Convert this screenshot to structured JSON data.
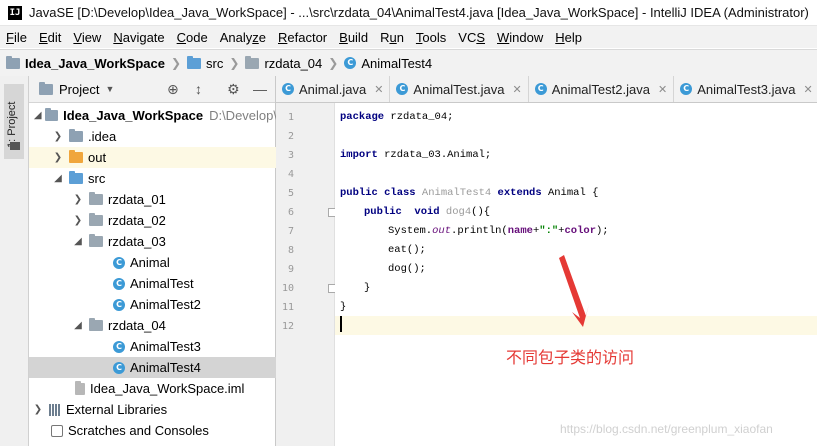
{
  "window": {
    "app_icon": "IJ",
    "title": "JavaSE [D:\\Develop\\Idea_Java_WorkSpace] - ...\\src\\rzdata_04\\AnimalTest4.java [Idea_Java_WorkSpace] - IntelliJ IDEA (Administrator)"
  },
  "menu": {
    "file": {
      "u": "F",
      "rest": "ile"
    },
    "edit": {
      "u": "E",
      "rest": "dit"
    },
    "view": {
      "u": "V",
      "rest": "iew"
    },
    "navigate": {
      "u": "N",
      "rest": "avigate"
    },
    "code": {
      "u": "C",
      "rest": "ode"
    },
    "analyze": {
      "pre": "Analy",
      "u": "z",
      "rest": "e"
    },
    "refactor": {
      "u": "R",
      "rest": "efactor"
    },
    "build": {
      "u": "B",
      "rest": "uild"
    },
    "run": {
      "pre": "R",
      "u": "u",
      "rest": "n"
    },
    "tools": {
      "u": "T",
      "rest": "ools"
    },
    "vcs": {
      "pre": "VC",
      "u": "S",
      "rest": ""
    },
    "window": {
      "u": "W",
      "rest": "indow"
    },
    "help": {
      "u": "H",
      "rest": "elp"
    }
  },
  "breadcrumbs": [
    "Idea_Java_WorkSpace",
    "src",
    "rzdata_04",
    "AnimalTest4"
  ],
  "tool_stripe": {
    "label": "1: Project"
  },
  "project_panel": {
    "title": "Project",
    "root": {
      "name": "Idea_Java_WorkSpace",
      "path": "D:\\Develop\\"
    },
    "items": [
      ".idea",
      "out",
      "src",
      "rzdata_01",
      "rzdata_02",
      "rzdata_03",
      "Animal",
      "AnimalTest",
      "AnimalTest2",
      "rzdata_04",
      "AnimalTest3",
      "AnimalTest4",
      "Idea_Java_WorkSpace.iml",
      "External Libraries",
      "Scratches and Consoles"
    ]
  },
  "editor_tabs": [
    "Animal.java",
    "AnimalTest.java",
    "AnimalTest2.java",
    "AnimalTest3.java"
  ],
  "line_numbers": [
    "1",
    "2",
    "3",
    "4",
    "5",
    "6",
    "7",
    "8",
    "9",
    "10",
    "11",
    "12"
  ],
  "code": {
    "l1_kw": "package",
    "l1_rest": " rzdata_04;",
    "l3_kw": "import",
    "l3_rest": " rzdata_03.Animal;",
    "l5_kw1": "public class",
    "l5_name": " AnimalTest4 ",
    "l5_kw2": "extends",
    "l5_rest": " Animal {",
    "l6_kw": "public  void",
    "l6_name": " dog4",
    "l6_rest": "(){",
    "l7_a": "System.",
    "l7_out": "out",
    "l7_b": ".println(",
    "l7_name": "name",
    "l7_c": "+",
    "l7_str": "\":\"",
    "l7_d": "+",
    "l7_color": "color",
    "l7_e": ");",
    "l8": "eat();",
    "l9": "dog();",
    "l10": "}",
    "l11": "}"
  },
  "annotation": "不同包子类的访问",
  "watermark": "https://blog.csdn.net/greenplum_xiaofan",
  "colors": {
    "annotation": "#e53935",
    "keyword": "#000080",
    "class_icon": "#3c9ad6",
    "out_folder": "#f0a63c"
  }
}
